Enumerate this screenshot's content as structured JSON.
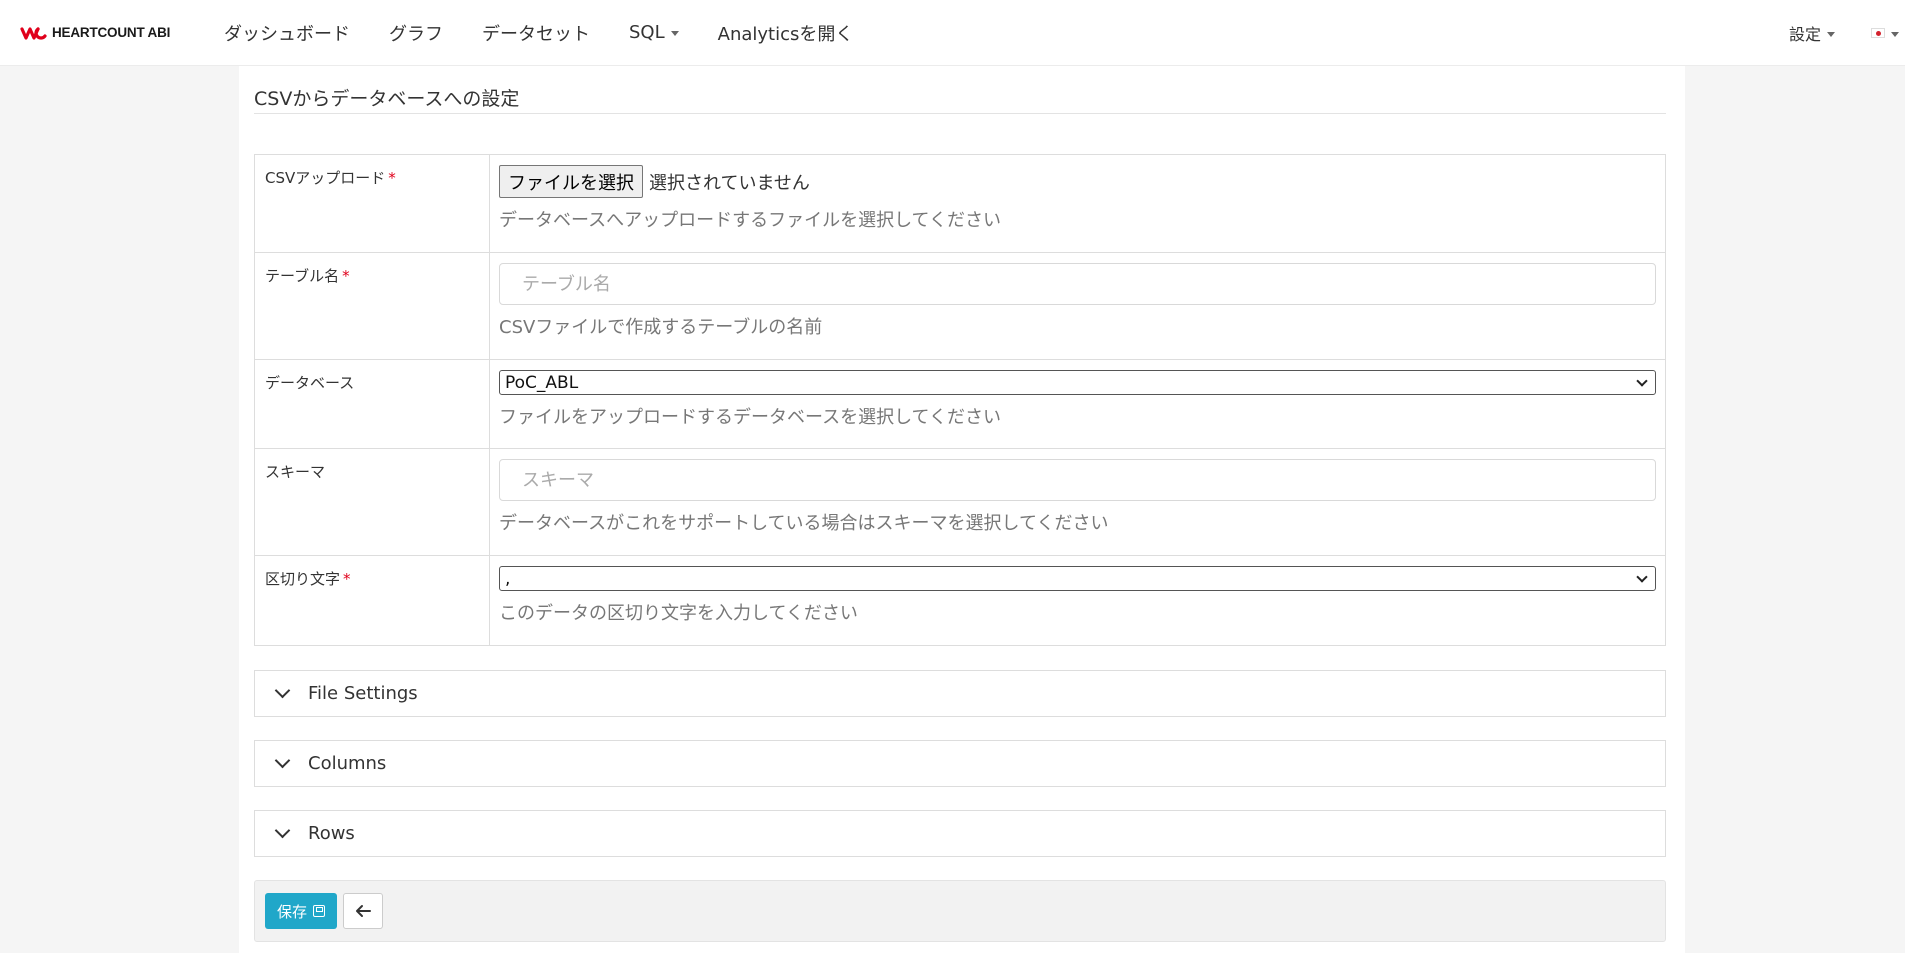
{
  "brand": {
    "name": "HEARTCOUNT ABI",
    "logo_icon": "heartcount-logo-icon",
    "color": "#e0001b"
  },
  "nav": {
    "items": [
      {
        "label": "ダッシュボード"
      },
      {
        "label": "グラフ"
      },
      {
        "label": "データセット"
      },
      {
        "label": "SQL",
        "dropdown": true
      },
      {
        "label": "Analyticsを開く"
      }
    ],
    "settings_label": "設定",
    "language_icon": "japan-flag-icon"
  },
  "page": {
    "title": "CSVからデータベースへの設定"
  },
  "form": {
    "csv_upload": {
      "label": "CSVアップロード",
      "required_mark": "*",
      "button_label": "ファイルを選択",
      "status": "選択されていません",
      "help": "データベースへアップロードするファイルを選択してください"
    },
    "table_name": {
      "label": "テーブル名",
      "required_mark": "*",
      "placeholder": "テーブル名",
      "value": "",
      "help": "CSVファイルで作成するテーブルの名前"
    },
    "database": {
      "label": "データベース",
      "selected": "PoC_ABL",
      "help": "ファイルをアップロードするデータベースを選択してください"
    },
    "schema": {
      "label": "スキーマ",
      "placeholder": "スキーマ",
      "value": "",
      "help": "データベースがこれをサポートしている場合はスキーマを選択してください"
    },
    "delimiter": {
      "label": "区切り文字",
      "required_mark": "*",
      "selected": ",",
      "help": "このデータの区切り文字を入力してください"
    }
  },
  "sections": [
    {
      "label": "File Settings"
    },
    {
      "label": "Columns"
    },
    {
      "label": "Rows"
    }
  ],
  "actions": {
    "save_label": "保存",
    "save_icon": "floppy-disk-icon",
    "back_icon": "arrow-left-icon",
    "save_color": "#20a7c9"
  }
}
